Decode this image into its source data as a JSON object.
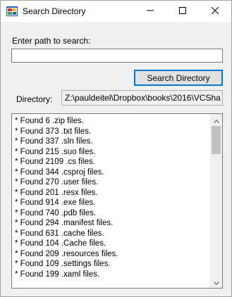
{
  "window": {
    "title": "Search Directory",
    "icon": "winforms-app-icon",
    "controls": [
      "minimize-icon",
      "maximize-icon",
      "close-icon"
    ]
  },
  "form": {
    "path_label": "Enter path to search:",
    "path_value": "",
    "search_button_label": "Search Directory",
    "directory_label": "Directory:",
    "directory_value": "Z:\\pauldeitel\\Dropbox\\books\\2016\\VCSha"
  },
  "results": [
    "* Found 6 .zip files.",
    "* Found 373 .txt files.",
    "* Found 337 .sln files.",
    "* Found 215 .suo files.",
    "* Found 2109 .cs files.",
    "* Found 344 .csproj files.",
    "* Found 270 .user files.",
    "* Found 201 .resx files.",
    "* Found 914 .exe files.",
    "* Found 740 .pdb files.",
    "* Found 294 .manifest files.",
    "* Found 631 .cache files.",
    "* Found 104 .Cache files.",
    "* Found 209 .resources files.",
    "* Found 109 .settings files.",
    "* Found 199 .xaml files."
  ],
  "colors": {
    "window_bg": "#f0f0f0",
    "titlebar_bg": "#ffffff",
    "button_focus_border": "#0078d7"
  }
}
